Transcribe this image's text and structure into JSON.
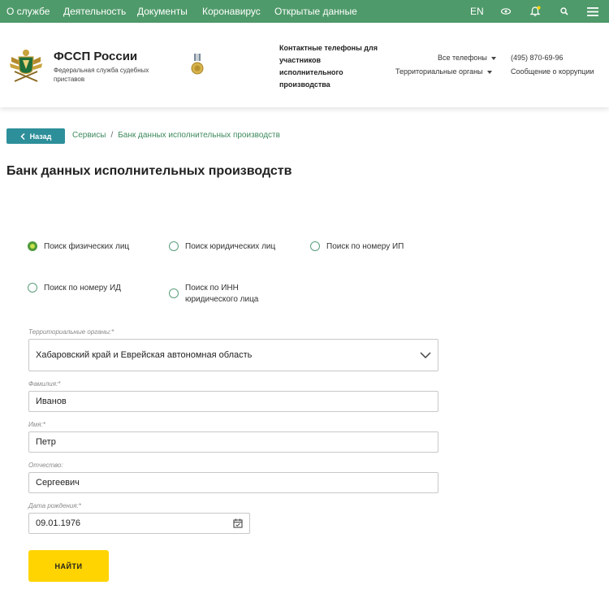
{
  "topnav": {
    "items": [
      "О службе",
      "Деятельность",
      "Документы",
      "Коронавирус",
      "Открытые данные"
    ],
    "lang": "EN",
    "icons": [
      "eye-icon",
      "bell-icon",
      "search-icon",
      "menu-icon"
    ],
    "color": "#4f9a6a"
  },
  "header": {
    "title": "ФССП России",
    "subtitle": "Федеральная служба судебных приставов",
    "contacts_title": "Контактные телефоны для участников исполнительного производства",
    "all_phones": "Все телефоны",
    "territorial": "Территориальные органы",
    "phone": "(495) 870-69-96",
    "corruption": "Сообщение о коррупции"
  },
  "breadcrumb": {
    "back": "Назад",
    "items": [
      "Сервисы",
      "Банк данных исполнительных производств"
    ],
    "separator": "/"
  },
  "page": {
    "title": "Банк данных исполнительных производств"
  },
  "search_type": {
    "options": [
      "Поиск физических лиц",
      "Поиск юридических лиц",
      "Поиск по номеру ИП",
      "Поиск по номеру ИД",
      "Поиск по ИНН юридического лица"
    ],
    "selected": "Поиск физических лиц"
  },
  "form": {
    "region": {
      "label": "Территориальные органы:*",
      "value": "Хабаровский край и Еврейская автономная область"
    },
    "last_name": {
      "label": "Фамилия:*",
      "value": "Иванов"
    },
    "first_name": {
      "label": "Имя:*",
      "value": "Петр"
    },
    "patronymic": {
      "label": "Отчество:",
      "value": "Сергеевич"
    },
    "birth_date": {
      "label": "Дата рождения:*",
      "value": "09.01.1976"
    },
    "submit": "НАЙТИ"
  },
  "colors": {
    "accent": "#4f9a6a",
    "back_button": "#2d8f9a",
    "submit": "#ffd400",
    "link": "#3e8a5e"
  }
}
